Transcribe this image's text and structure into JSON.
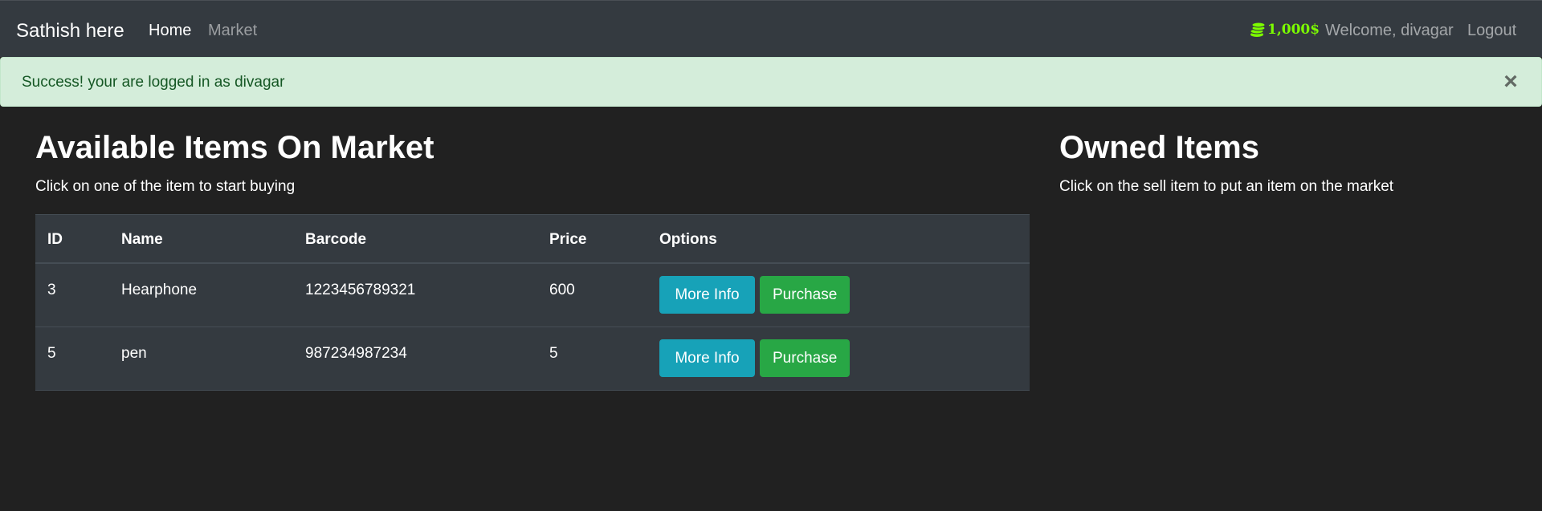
{
  "navbar": {
    "brand": "Sathish here",
    "links": [
      {
        "label": "Home",
        "active": true
      },
      {
        "label": "Market",
        "active": false
      }
    ],
    "budget": "1,000$",
    "budget_icon": "coins-icon",
    "welcome": "Welcome, divagar",
    "logout": "Logout"
  },
  "alert": {
    "message": "Success! your are logged in as divagar",
    "close_symbol": "×",
    "type": "success"
  },
  "market": {
    "title": "Available Items On Market",
    "subtitle": "Click on one of the item to start buying",
    "columns": [
      "ID",
      "Name",
      "Barcode",
      "Price",
      "Options"
    ],
    "rows": [
      {
        "id": "3",
        "name": "Hearphone",
        "barcode": "1223456789321",
        "price": "600",
        "info_label": "More Info",
        "purchase_label": "Purchase"
      },
      {
        "id": "5",
        "name": "pen",
        "barcode": "987234987234",
        "price": "5",
        "info_label": "More Info",
        "purchase_label": "Purchase"
      }
    ]
  },
  "owned": {
    "title": "Owned Items",
    "subtitle": "Click on the sell item to put an item on the market"
  },
  "colors": {
    "background": "#212121",
    "navbar": "#343a40",
    "alert_bg": "#d4edda",
    "alert_text": "#155724",
    "info": "#17a2b8",
    "success": "#28a745",
    "budget": "#7cfc00"
  }
}
